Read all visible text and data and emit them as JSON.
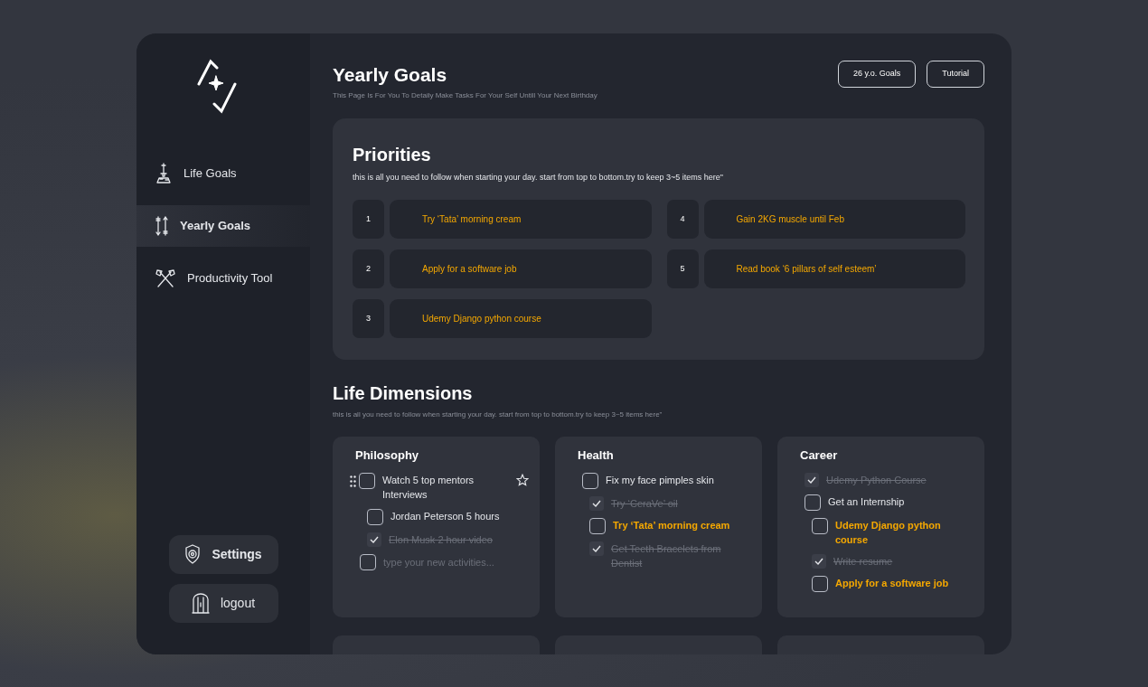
{
  "sidebar": {
    "items": [
      {
        "label": "Life Goals",
        "selected": false
      },
      {
        "label": "Yearly Goals",
        "selected": true
      },
      {
        "label": "Productivity Tool",
        "selected": false
      }
    ],
    "footer_buttons": [
      {
        "label": "Settings"
      },
      {
        "label": "logout"
      }
    ]
  },
  "header": {
    "title": "Yearly Goals",
    "subtitle": "This Page Is For You To Detaily Make Tasks For Your Self Untill Your Next Birthday",
    "buttons": [
      "26 y.o. Goals",
      "Tutorial"
    ]
  },
  "priorities": {
    "title": "Priorities",
    "description": "this is all you need to follow when starting your day. start from top to bottom.try to keep 3~5 items here\"",
    "items": [
      {
        "number": "1",
        "text": "Try ‘Tata’ morning cream"
      },
      {
        "number": "2",
        "text": "Apply for a software job"
      },
      {
        "number": "3",
        "text": "Udemy Django python course"
      },
      {
        "number": "4",
        "text": "Gain 2KG muscle until Feb"
      },
      {
        "number": "5",
        "text": "Read book ‘6 pillars of self esteem’"
      }
    ]
  },
  "dimensions": {
    "title": "Life Dimensions",
    "description": "this is all you need to follow when starting your day. start from top to bottom.try to keep 3~5 items here\"",
    "cards": [
      {
        "kind": "card",
        "title": "Philosophy",
        "items": [
          {
            "kind": "task",
            "text": "Watch 5 top mentors Interviews",
            "checked": false,
            "highlighted": false,
            "draggable": true,
            "starred": false,
            "children": [
              {
                "kind": "task",
                "text": "Jordan Peterson 5 hours",
                "checked": false,
                "highlighted": false
              },
              {
                "kind": "task",
                "text": "Elon Musk 2 hour video",
                "checked": true
              }
            ]
          },
          {
            "kind": "input",
            "placeholder": "type your new activities...",
            "checked": false
          }
        ]
      },
      {
        "kind": "card",
        "title": "Health",
        "items": [
          {
            "kind": "task",
            "text": "Fix my face pimples skin",
            "checked": false,
            "highlighted": false,
            "children": [
              {
                "kind": "task",
                "text": "Try ‘CeraVe’ oil",
                "checked": true
              },
              {
                "kind": "task",
                "text": "Try ‘Tata’ morning cream",
                "checked": false,
                "highlighted": true
              },
              {
                "kind": "task",
                "text": "Get Teeth Bracelets from Dentist",
                "checked": true
              }
            ]
          }
        ]
      },
      {
        "kind": "card",
        "title": "Career",
        "items": [
          {
            "kind": "task",
            "text": "Udemy Python Course",
            "checked": true
          },
          {
            "kind": "task",
            "text": "Get an Internship",
            "checked": false,
            "highlighted": false,
            "children": [
              {
                "kind": "task",
                "text": "Udemy Django python course",
                "checked": false,
                "highlighted": true
              },
              {
                "kind": "task",
                "text": "Write resume",
                "checked": true
              },
              {
                "kind": "task",
                "text": "Apply for a software job",
                "checked": false,
                "highlighted": true
              }
            ]
          }
        ]
      },
      {
        "kind": "cut"
      },
      {
        "kind": "cut"
      },
      {
        "kind": "cut"
      }
    ]
  }
}
